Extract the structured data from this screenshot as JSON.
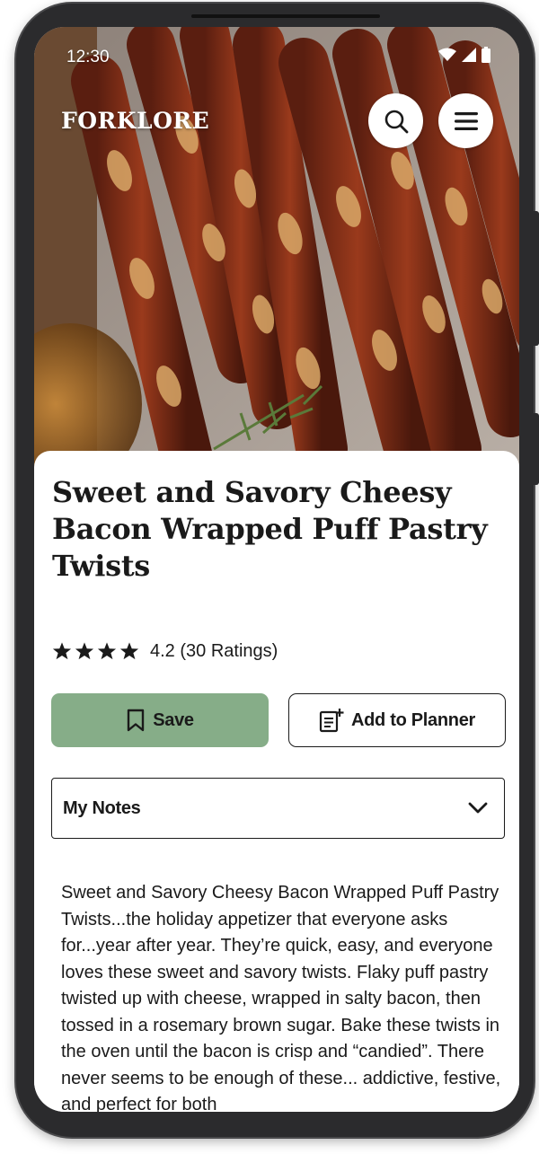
{
  "status_bar": {
    "time": "12:30"
  },
  "header": {
    "brand": "FORKLORE",
    "search_icon": "search-icon",
    "menu_icon": "hamburger-menu-icon"
  },
  "recipe": {
    "title": "Sweet and Savory Cheesy Bacon Wrapped Puff Pastry Twists",
    "rating_value": 4.2,
    "rating_stars_shown": 4,
    "rating_text": "4.2 (30 Ratings)",
    "description": "Sweet and Savory Cheesy Bacon Wrapped Puff Pastry Twists...the holiday appetizer that everyone asks for...year after year. They’re quick, easy, and everyone loves these sweet and savory twists. Flaky puff pastry twisted up with cheese, wrapped in salty bacon, then tossed in a rosemary brown sugar. Bake these twists in the oven until the bacon is crisp and “candied”. There never seems to be enough of these... addictive, festive, and perfect for both"
  },
  "actions": {
    "save_label": "Save",
    "planner_label": "Add to Planner"
  },
  "notes": {
    "label": "My Notes"
  },
  "colors": {
    "save_button": "#86ad88",
    "text": "#1a1a1a",
    "device_frame": "#2b2b2d"
  }
}
